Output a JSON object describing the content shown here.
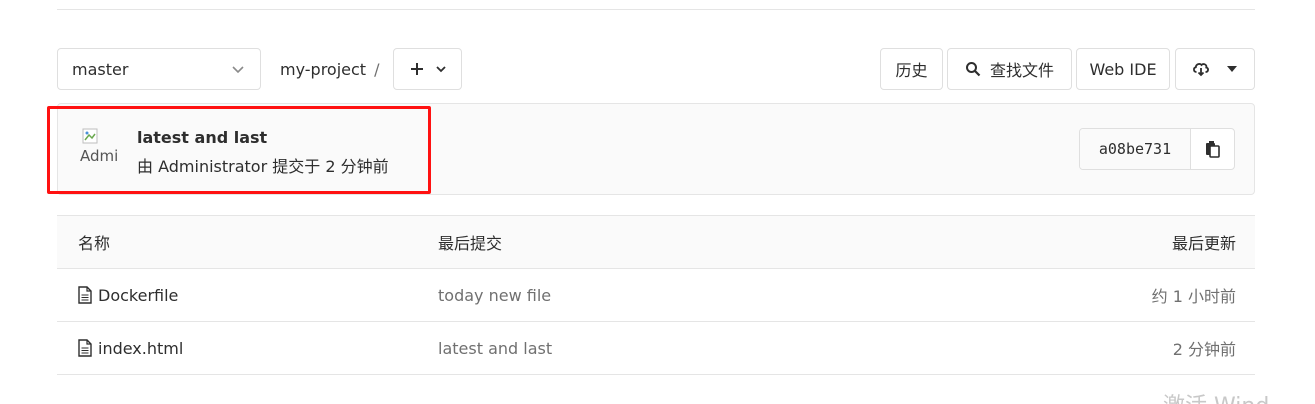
{
  "toolbar": {
    "branch": "master",
    "project": "my-project",
    "separator": "/",
    "history_label": "历史",
    "find_file_label": "查找文件",
    "web_ide_label": "Web IDE"
  },
  "last_commit": {
    "title": "latest and last",
    "meta": "由 Administrator 提交于 2 分钟前",
    "avatar_alt": "Admi",
    "sha": "a08be731"
  },
  "files": {
    "headers": {
      "name": "名称",
      "last_commit": "最后提交",
      "last_update": "最后更新"
    },
    "rows": [
      {
        "name": "Dockerfile",
        "last_commit": "today new file",
        "last_update": "约 1 小时前",
        "icon": "file-icon"
      },
      {
        "name": "index.html",
        "last_commit": "latest and last",
        "last_update": "2 分钟前",
        "icon": "file-icon"
      }
    ]
  },
  "overlay": {
    "watermark": "激活 Wind",
    "highlight_color": "#ff1111"
  }
}
